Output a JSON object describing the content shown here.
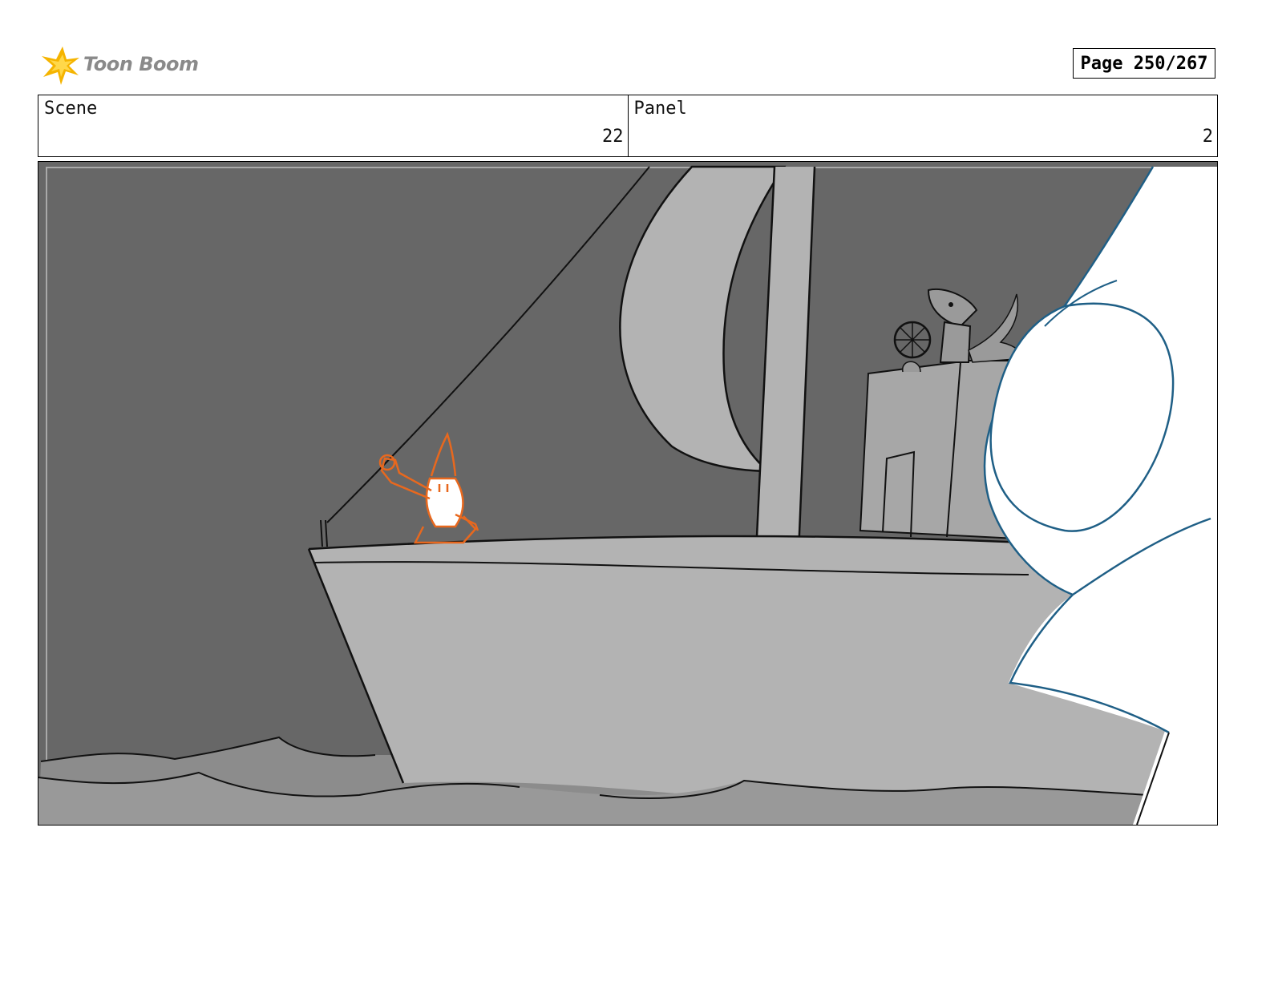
{
  "header": {
    "logo": {
      "text": "Toon Boom",
      "icon": "toon-boom-starburst-icon",
      "colors": {
        "burst": "#f5b400",
        "burst_light": "#ffd84a",
        "text": "#8a8a8a"
      }
    },
    "page_label": "Page 250/267"
  },
  "info": {
    "scene": {
      "label": "Scene",
      "value": "22"
    },
    "panel": {
      "label": "Panel",
      "value": "2"
    }
  },
  "artwork": {
    "colors": {
      "sky": "#676767",
      "ship": "#b3b3b3",
      "sea_back": "#8c8c8c",
      "sea_front": "#999999",
      "creature_outline": "#1f5f86",
      "hero_outline": "#e8681e",
      "ink": "#111111"
    }
  }
}
